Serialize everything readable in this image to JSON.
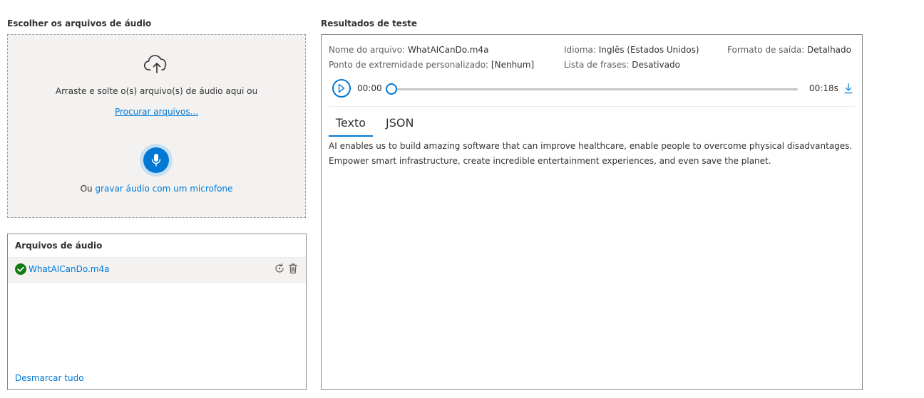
{
  "left": {
    "title": "Escolher os arquivos de áudio",
    "drop_text": "Arraste e solte o(s) arquivo(s) de áudio aqui ou",
    "browse_link": "Procurar arquivos...",
    "record_prefix": "Ou",
    "record_link": "gravar áudio com um microfone"
  },
  "files": {
    "title": "Arquivos de áudio",
    "items": [
      {
        "name": "WhatAICanDo.m4a",
        "status": "success"
      }
    ],
    "deselect_all": "Desmarcar tudo"
  },
  "results": {
    "title": "Resultados de teste",
    "file_label": "Nome do arquivo:",
    "file_value": "WhatAICanDo.m4a",
    "language_label": "Idioma:",
    "language_value": "Inglês (Estados Unidos)",
    "format_label": "Formato de saída:",
    "format_value": "Detalhado",
    "endpoint_label": "Ponto de extremidade personalizado:",
    "endpoint_value": "[Nenhum]",
    "phrases_label": "Lista de frases:",
    "phrases_value": "Desativado",
    "player": {
      "current_time": "00:00",
      "duration": "00:18s",
      "progress": 0
    },
    "tabs": [
      {
        "label": "Texto",
        "selected": true
      },
      {
        "label": "JSON",
        "selected": false
      }
    ],
    "transcript": "AI enables us to build amazing software that can improve healthcare, enable people to overcome physical disadvantages. Empower smart infrastructure, create incredible entertainment experiences, and even save the planet."
  },
  "colors": {
    "accent": "#0078d4",
    "success": "#107c10"
  }
}
